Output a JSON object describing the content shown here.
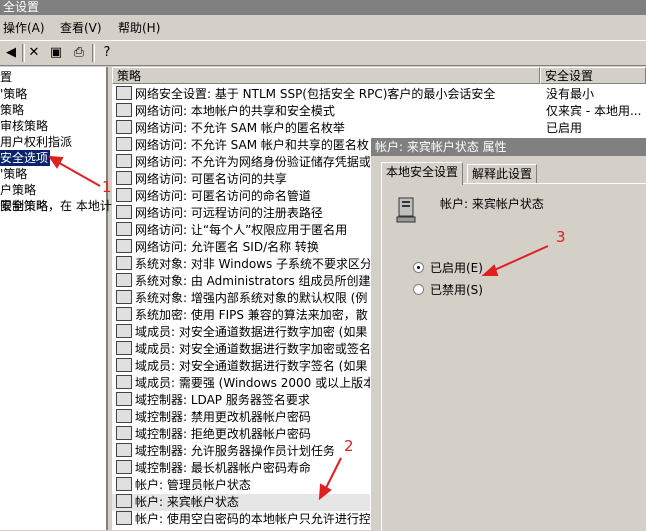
{
  "window": {
    "title": "全设置"
  },
  "menu": {
    "items": [
      "操作(A)",
      "查看(V)",
      "帮助(H)"
    ]
  },
  "toolbar": {
    "icons": [
      "back-icon",
      "forward-icon",
      "delete-icon",
      "properties-icon",
      "export-icon",
      "help-icon"
    ]
  },
  "tree": {
    "items": [
      "置",
      "'策略",
      "策略",
      "审核策略",
      "用户权利指派",
      "安全选项",
      "'策略",
      "户策略",
      "限制策略",
      "安全策略，在 本地计"
    ],
    "selected_index": 5
  },
  "list": {
    "columns": [
      "策略",
      "安全设置"
    ],
    "rows": [
      {
        "policy": "网络安全设置: 基于 NTLM SSP(包括安全 RPC)客户的最小会话安全",
        "setting": "没有最小"
      },
      {
        "policy": "网络访问: 本地帐户的共享和安全模式",
        "setting": "仅来宾 - 本地用..."
      },
      {
        "policy": "网络访问: 不允许 SAM 帐户的匿名枚举",
        "setting": "已启用"
      },
      {
        "policy": "网络访问: 不允许 SAM 帐户和共享的匿名枚",
        "setting": ""
      },
      {
        "policy": "网络访问: 不允许为网络身份验证储存凭据或",
        "setting": ""
      },
      {
        "policy": "网络访问: 可匿名访问的共享",
        "setting": ""
      },
      {
        "policy": "网络访问: 可匿名访问的命名管道",
        "setting": ""
      },
      {
        "policy": "网络访问: 可远程访问的注册表路径",
        "setting": ""
      },
      {
        "policy": "网络访问: 让“每个人”权限应用于匿名用",
        "setting": ""
      },
      {
        "policy": "网络访问: 允许匿名 SID/名称 转换",
        "setting": ""
      },
      {
        "policy": "系统对象: 对非 Windows 子系统不要求区分",
        "setting": ""
      },
      {
        "policy": "系统对象: 由 Administrators 组成员所创建",
        "setting": ""
      },
      {
        "policy": "系统对象: 增强内部系统对象的默认权限 (例",
        "setting": ""
      },
      {
        "policy": "系统加密: 使用 FIPS 兼容的算法来加密，散",
        "setting": ""
      },
      {
        "policy": "域成员: 对安全通道数据进行数字加密 (如果",
        "setting": ""
      },
      {
        "policy": "域成员: 对安全通道数据进行数字加密或签名",
        "setting": ""
      },
      {
        "policy": "域成员: 对安全通道数据进行数字签名 (如果",
        "setting": ""
      },
      {
        "policy": "域成员: 需要强 (Windows 2000 或以上版本",
        "setting": ""
      },
      {
        "policy": "域控制器: LDAP 服务器签名要求",
        "setting": ""
      },
      {
        "policy": "域控制器: 禁用更改机器帐户密码",
        "setting": ""
      },
      {
        "policy": "域控制器: 拒绝更改机器帐户密码",
        "setting": ""
      },
      {
        "policy": "域控制器: 允许服务器操作员计划任务",
        "setting": ""
      },
      {
        "policy": "域控制器: 最长机器帐户密码寿命",
        "setting": ""
      },
      {
        "policy": "帐户: 管理员帐户状态",
        "setting": ""
      },
      {
        "policy": "帐户: 来宾帐户状态",
        "setting": ""
      },
      {
        "policy": "帐户: 使用空白密码的本地帐户只允许进行控",
        "setting": ""
      }
    ],
    "highlighted_index": 24
  },
  "dialog": {
    "title": "帐户: 来宾帐户状态 属性",
    "tabs": [
      "本地安全设置",
      "解释此设置"
    ],
    "active_tab": 0,
    "policy_name": "帐户: 来宾帐户状态",
    "options": [
      {
        "label": "已启用(E)",
        "checked": true
      },
      {
        "label": "已禁用(S)",
        "checked": false
      }
    ]
  },
  "annotations": {
    "labels": [
      "1",
      "2",
      "3"
    ],
    "color": "#e02020"
  }
}
